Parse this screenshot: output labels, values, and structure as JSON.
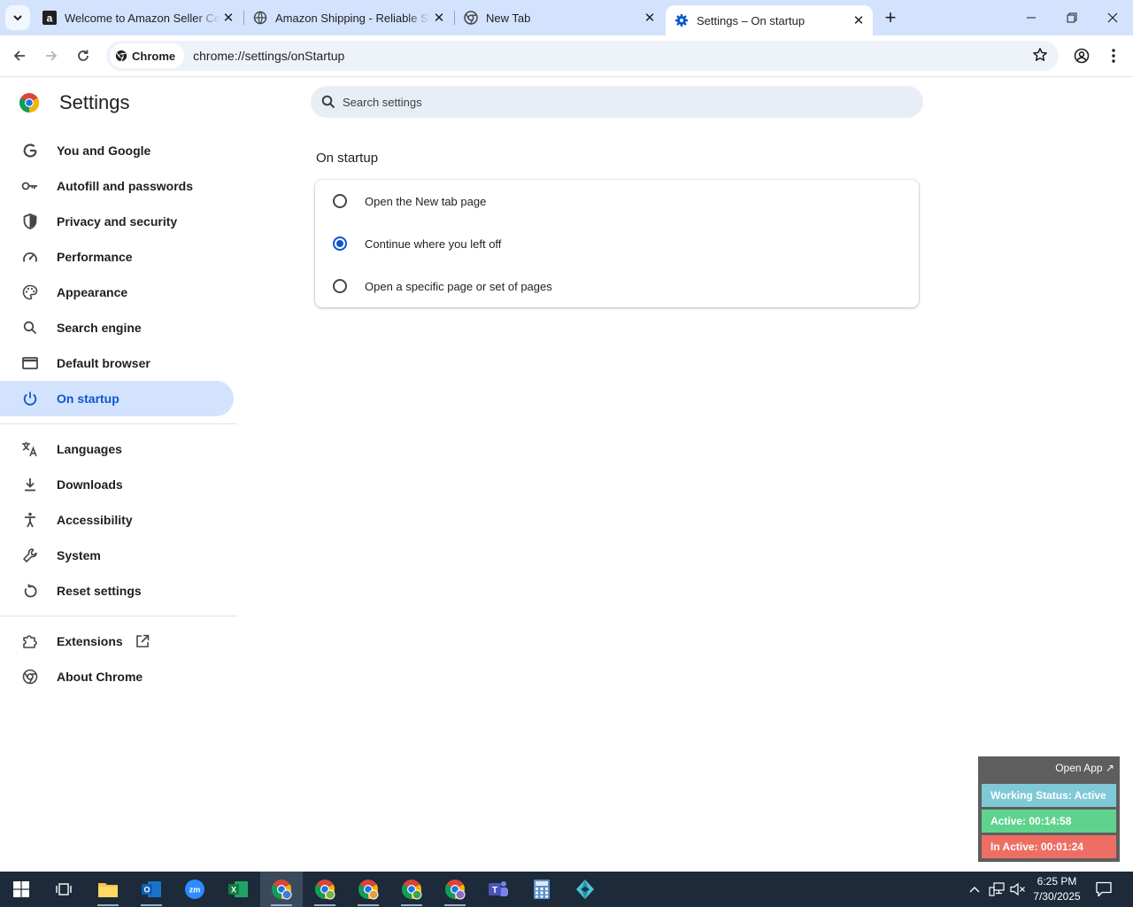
{
  "browser": {
    "tabs": [
      {
        "title": "Welcome to Amazon Seller Central",
        "favicon": "amazon-icon",
        "active": false
      },
      {
        "title": "Amazon Shipping - Reliable Shipping",
        "favicon": "globe-icon",
        "active": false
      },
      {
        "title": "New Tab",
        "favicon": "chrome-icon",
        "active": false
      },
      {
        "title": "Settings – On startup",
        "favicon": "gear-icon",
        "active": true
      }
    ],
    "omnibox": {
      "chip_label": "Chrome",
      "url": "chrome://settings/onStartup"
    }
  },
  "settings": {
    "title": "Settings",
    "search_placeholder": "Search settings",
    "nav": {
      "you_and_google": "You and Google",
      "autofill": "Autofill and passwords",
      "privacy": "Privacy and security",
      "performance": "Performance",
      "appearance": "Appearance",
      "search_engine": "Search engine",
      "default_browser": "Default browser",
      "on_startup": "On startup",
      "languages": "Languages",
      "downloads": "Downloads",
      "accessibility": "Accessibility",
      "system": "System",
      "reset": "Reset settings",
      "extensions": "Extensions",
      "about": "About Chrome"
    },
    "section_title": "On startup",
    "options": [
      {
        "label": "Open the New tab page",
        "checked": false
      },
      {
        "label": "Continue where you left off",
        "checked": true
      },
      {
        "label": "Open a specific page or set of pages",
        "checked": false
      }
    ]
  },
  "widget": {
    "open_app": "Open App ↗",
    "status": "Working Status: Active",
    "active": "Active: 00:14:58",
    "inactive": "In Active: 00:01:24"
  },
  "taskbar": {
    "time": "6:25 PM",
    "date": "7/30/2025"
  },
  "colors": {
    "accent": "#0b57d0",
    "tabstrip": "#d3e3fd",
    "status_bar": "#7fc9d6",
    "active_bar": "#5fd38e",
    "inactive_bar": "#ee6e63"
  }
}
